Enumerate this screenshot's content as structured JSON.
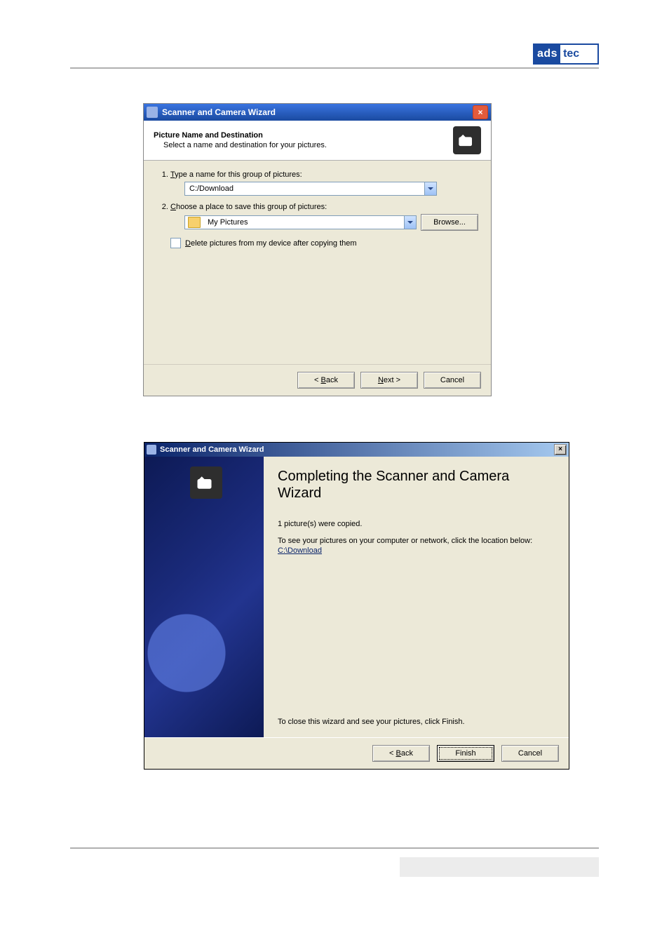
{
  "logo": {
    "left": "ads",
    "right": "tec"
  },
  "dialog1": {
    "title": "Scanner and Camera Wizard",
    "header_title": "Picture Name and Destination",
    "header_sub": "Select a name and destination for your pictures.",
    "step1_label": "Type a name for this group of pictures:",
    "name_value": "C:/Download",
    "step2_label": "Choose a place to save this group of pictures:",
    "place_value": "My Pictures",
    "browse_label": "Browse...",
    "delete_checkbox_label": "Delete pictures from my device after copying them",
    "back_label": "< Back",
    "next_label": "Next >",
    "cancel_label": "Cancel"
  },
  "dialog2": {
    "title": "Scanner and Camera Wizard",
    "heading": "Completing the Scanner and Camera Wizard",
    "copied_line": "1 picture(s) were copied.",
    "see_line": "To see your pictures on your computer or network, click the location below:",
    "location_link": "C:\\Download",
    "close_line": "To close this wizard and see your pictures, click Finish.",
    "back_label": "< Back",
    "finish_label": "Finish",
    "cancel_label": "Cancel"
  }
}
